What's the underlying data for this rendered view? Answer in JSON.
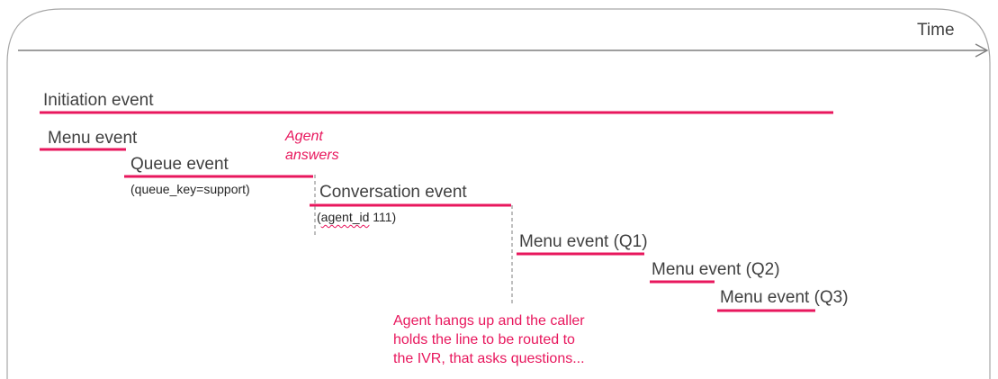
{
  "time_label": "Time",
  "accent_color": "#e8175d",
  "events": {
    "initiation": "Initiation event",
    "menu": "Menu event",
    "queue": "Queue event",
    "queue_detail": "(queue_key=support)",
    "conversation": "Conversation event",
    "conversation_detail_prefix": "(",
    "conversation_detail_key": "agent_id",
    "conversation_detail_value": " 111)",
    "menu_q1": "Menu event (Q1)",
    "menu_q2": "Menu event (Q2)",
    "menu_q3": "Menu event (Q3)"
  },
  "annotations": {
    "agent_answers_line1": "Agent",
    "agent_answers_line2": "answers",
    "hangup_line1": "Agent hangs up and the caller",
    "hangup_line2": "holds the line to be routed to",
    "hangup_line3": "the IVR, that asks questions..."
  }
}
